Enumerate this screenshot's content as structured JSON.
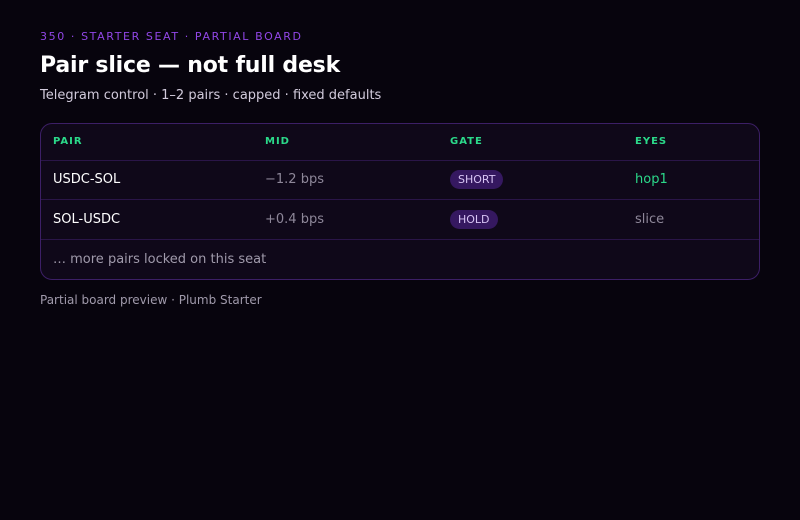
{
  "header": {
    "eyebrow": "350 · STARTER SEAT · PARTIAL BOARD",
    "title": "Pair slice — not full desk",
    "subtitle": "Telegram control · 1–2 pairs · capped · fixed defaults"
  },
  "table": {
    "columns": [
      "PAIR",
      "MID",
      "GATE",
      "EYES"
    ],
    "rows": [
      {
        "pair": "USDC-SOL",
        "mid": "−1.2 bps",
        "gate": "SHORT",
        "eyes": "hop1"
      },
      {
        "pair": "SOL-USDC",
        "mid": "+0.4 bps",
        "gate": "HOLD",
        "eyes": "slice"
      }
    ],
    "locked_note": "… more pairs locked on this seat"
  },
  "footer": {
    "text": "Partial board preview · Plumb Starter"
  },
  "colors": {
    "background": "#07040d",
    "accent_purple": "#9146e6",
    "accent_green": "#2bd98a",
    "badge_bg": "#351860"
  }
}
